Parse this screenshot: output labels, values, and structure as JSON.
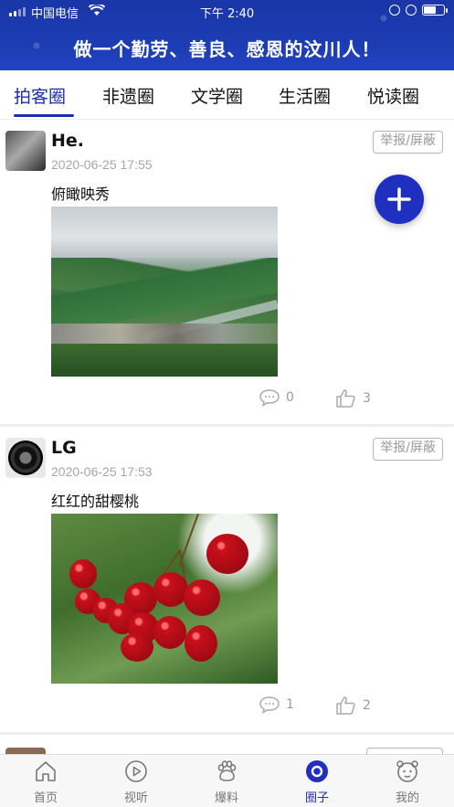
{
  "status_bar": {
    "carrier": "中国电信",
    "time": "下午 2:40"
  },
  "banner": {
    "slogan": "做一个勤劳、善良、感恩的汶川人！"
  },
  "tabs": [
    {
      "label": "拍客圈",
      "active": true
    },
    {
      "label": "非遗圈",
      "active": false
    },
    {
      "label": "文学圈",
      "active": false
    },
    {
      "label": "生活圈",
      "active": false
    },
    {
      "label": "悦读圈",
      "active": false
    }
  ],
  "posts": [
    {
      "username": "He.",
      "timestamp": "2020-06-25 17:55",
      "caption": "俯瞰映秀",
      "report_label": "举报/屏蔽",
      "comments": "0",
      "likes": "3"
    },
    {
      "username": "LG",
      "timestamp": "2020-06-25 17:53",
      "caption": "红红的甜樱桃",
      "report_label": "举报/屏蔽",
      "comments": "1",
      "likes": "2"
    }
  ],
  "tabbar": [
    {
      "label": "首页",
      "icon": "home-icon",
      "active": false
    },
    {
      "label": "视听",
      "icon": "play-icon",
      "active": false
    },
    {
      "label": "爆料",
      "icon": "paw-icon",
      "active": false
    },
    {
      "label": "圈子",
      "icon": "circle-icon",
      "active": true
    },
    {
      "label": "我的",
      "icon": "profile-icon",
      "active": false
    }
  ],
  "colors": {
    "brand": "#1a2fa8",
    "fab": "#1f2fbf",
    "muted": "#999999"
  }
}
